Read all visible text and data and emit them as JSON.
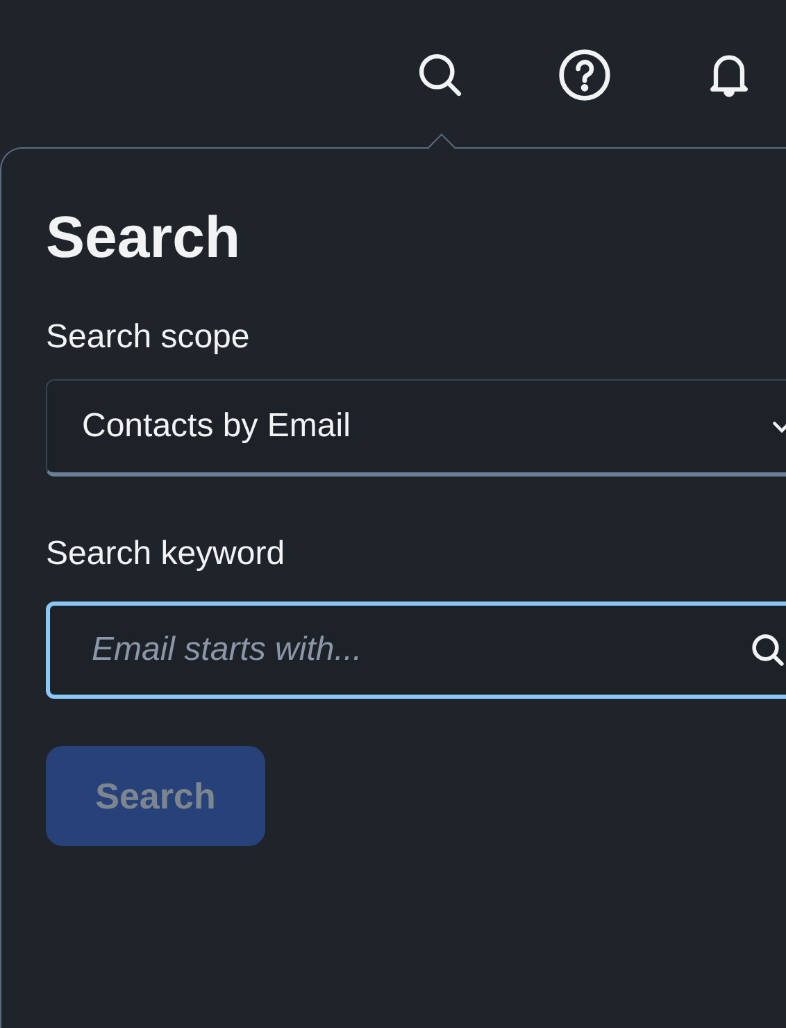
{
  "toolbar": {
    "search_open": true
  },
  "popover": {
    "title": "Search",
    "scope": {
      "label": "Search scope",
      "value": "Contacts by Email"
    },
    "keyword": {
      "label": "Search keyword",
      "placeholder": "Email starts with...",
      "focused": true
    },
    "button": {
      "label": "Search",
      "disabled": true
    }
  }
}
